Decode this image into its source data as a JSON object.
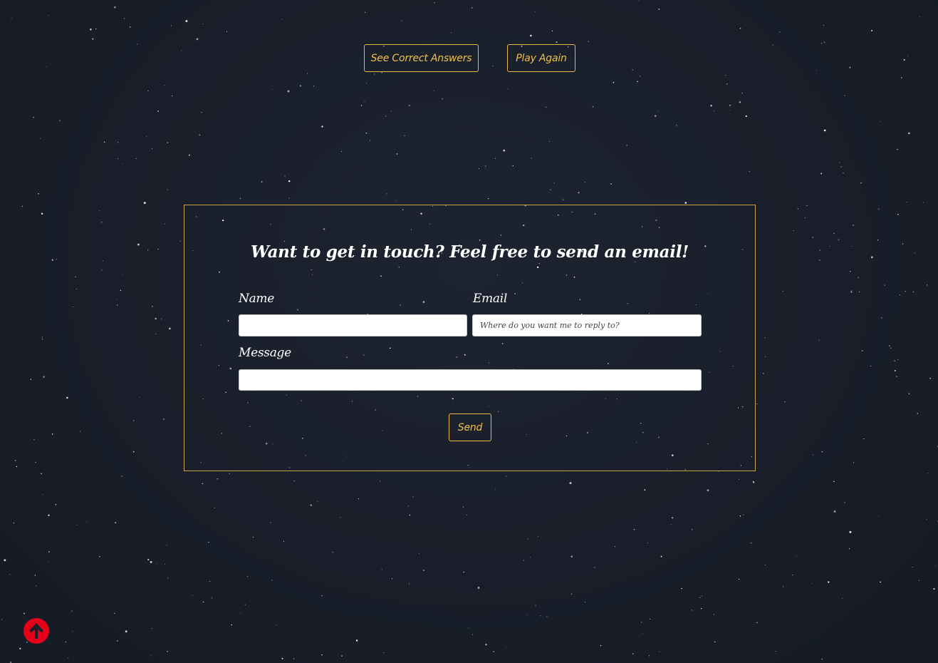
{
  "results": {
    "see_answers_label": "See Correct Answers",
    "play_again_label": "Play Again"
  },
  "contact": {
    "title": "Want to get in touch? Feel free to send an email!",
    "name_label": "Name",
    "name_value": "",
    "email_label": "Email",
    "email_placeholder": "Where do you want me to reply to?",
    "message_label": "Message",
    "message_value": "",
    "send_label": "Send"
  },
  "icons": {
    "scroll_top": "arrow-circle-up-icon"
  },
  "colors": {
    "background": "#1a1f2b",
    "accent": "#f0c04a",
    "border": "#c9a548",
    "scroll_top": "#e8001a"
  }
}
